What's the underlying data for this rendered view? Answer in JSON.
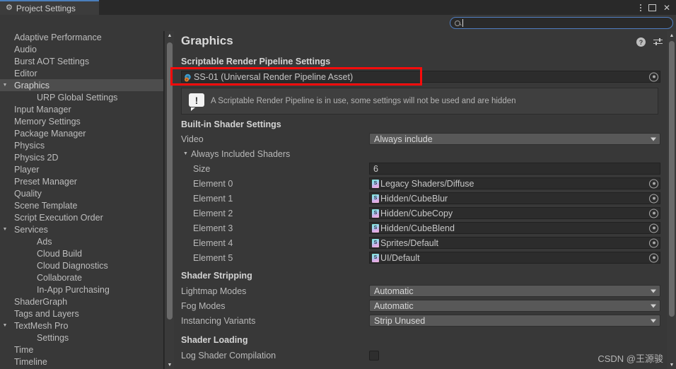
{
  "window": {
    "tab_label": "Project Settings",
    "tab_icon": "gear-icon",
    "controls": {
      "menu": "kebab-menu-icon",
      "maximize": "maximize-icon",
      "close": "✕"
    }
  },
  "search": {
    "value": "",
    "placeholder": "",
    "icon": "search-icon"
  },
  "sidebar": {
    "items": [
      {
        "label": "Adaptive Performance",
        "depth": 0,
        "expandable": false,
        "selected": false
      },
      {
        "label": "Audio",
        "depth": 0,
        "expandable": false,
        "selected": false
      },
      {
        "label": "Burst AOT Settings",
        "depth": 0,
        "expandable": false,
        "selected": false
      },
      {
        "label": "Editor",
        "depth": 0,
        "expandable": false,
        "selected": false
      },
      {
        "label": "Graphics",
        "depth": 0,
        "expandable": true,
        "selected": true
      },
      {
        "label": "URP Global Settings",
        "depth": 1,
        "expandable": false,
        "selected": false
      },
      {
        "label": "Input Manager",
        "depth": 0,
        "expandable": false,
        "selected": false
      },
      {
        "label": "Memory Settings",
        "depth": 0,
        "expandable": false,
        "selected": false
      },
      {
        "label": "Package Manager",
        "depth": 0,
        "expandable": false,
        "selected": false
      },
      {
        "label": "Physics",
        "depth": 0,
        "expandable": false,
        "selected": false
      },
      {
        "label": "Physics 2D",
        "depth": 0,
        "expandable": false,
        "selected": false
      },
      {
        "label": "Player",
        "depth": 0,
        "expandable": false,
        "selected": false
      },
      {
        "label": "Preset Manager",
        "depth": 0,
        "expandable": false,
        "selected": false
      },
      {
        "label": "Quality",
        "depth": 0,
        "expandable": false,
        "selected": false
      },
      {
        "label": "Scene Template",
        "depth": 0,
        "expandable": false,
        "selected": false
      },
      {
        "label": "Script Execution Order",
        "depth": 0,
        "expandable": false,
        "selected": false
      },
      {
        "label": "Services",
        "depth": 0,
        "expandable": true,
        "selected": false
      },
      {
        "label": "Ads",
        "depth": 1,
        "expandable": false,
        "selected": false
      },
      {
        "label": "Cloud Build",
        "depth": 1,
        "expandable": false,
        "selected": false
      },
      {
        "label": "Cloud Diagnostics",
        "depth": 1,
        "expandable": false,
        "selected": false
      },
      {
        "label": "Collaborate",
        "depth": 1,
        "expandable": false,
        "selected": false
      },
      {
        "label": "In-App Purchasing",
        "depth": 1,
        "expandable": false,
        "selected": false
      },
      {
        "label": "ShaderGraph",
        "depth": 0,
        "expandable": false,
        "selected": false
      },
      {
        "label": "Tags and Layers",
        "depth": 0,
        "expandable": false,
        "selected": false
      },
      {
        "label": "TextMesh Pro",
        "depth": 0,
        "expandable": true,
        "selected": false
      },
      {
        "label": "Settings",
        "depth": 1,
        "expandable": false,
        "selected": false
      },
      {
        "label": "Time",
        "depth": 0,
        "expandable": false,
        "selected": false
      },
      {
        "label": "Timeline",
        "depth": 0,
        "expandable": false,
        "selected": false
      }
    ]
  },
  "panel": {
    "title": "Graphics",
    "icons": {
      "help": "?",
      "settings": "settings-sliders-icon",
      "menu": "kebab-menu-icon"
    },
    "srp_section_label": "Scriptable Render Pipeline Settings",
    "srp_asset": {
      "value": "SS-01 (Universal Render Pipeline Asset)",
      "icon": "urp-asset-icon"
    },
    "helpbox": {
      "icon": "info-icon",
      "text": "A Scriptable Render Pipeline is in use, some settings will not be used and are hidden"
    },
    "builtin_shader_settings": {
      "heading": "Built-in Shader Settings",
      "video_label": "Video",
      "video_value": "Always include",
      "always_included_label": "Always Included Shaders",
      "size_label": "Size",
      "size_value": "6",
      "elements": [
        {
          "label": "Element 0",
          "value": "Legacy Shaders/Diffuse"
        },
        {
          "label": "Element 1",
          "value": "Hidden/CubeBlur"
        },
        {
          "label": "Element 2",
          "value": "Hidden/CubeCopy"
        },
        {
          "label": "Element 3",
          "value": "Hidden/CubeBlend"
        },
        {
          "label": "Element 4",
          "value": "Sprites/Default"
        },
        {
          "label": "Element 5",
          "value": "UI/Default"
        }
      ]
    },
    "shader_stripping": {
      "heading": "Shader Stripping",
      "rows": [
        {
          "label": "Lightmap Modes",
          "value": "Automatic"
        },
        {
          "label": "Fog Modes",
          "value": "Automatic"
        },
        {
          "label": "Instancing Variants",
          "value": "Strip Unused"
        }
      ]
    },
    "shader_loading": {
      "heading": "Shader Loading",
      "log_label": "Log Shader Compilation",
      "log_checked": false
    }
  },
  "watermark": "CSDN @王源骏",
  "colors": {
    "background": "#383838",
    "tab_accent": "#4a7ebb",
    "selection": "#4d4d4d",
    "annotation": "#fb0b0b",
    "dropdown": "#585858",
    "field": "#2c2c2c"
  }
}
